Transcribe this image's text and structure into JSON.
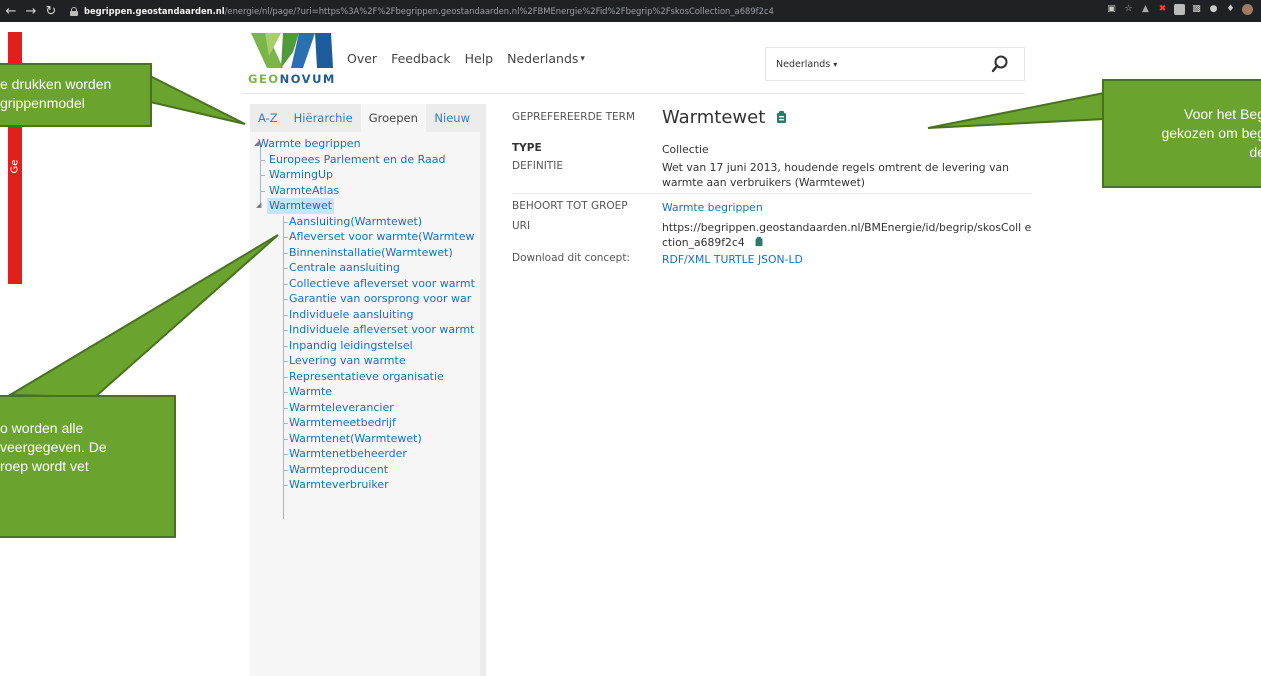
{
  "browser": {
    "url_host": "begrippen.geostandaarden.nl",
    "url_path": "/energie/nl/page/?uri=https%3A%2F%2Fbegrippen.geostandaarden.nl%2FBMEnergie%2Fid%2Fbegrip%2FskosCollection_a689f2c4"
  },
  "side": {
    "vertical_text": "Ge"
  },
  "header": {
    "logo_geo": "GEO",
    "logo_novum": "NOVUM",
    "nav": [
      "Over",
      "Feedback",
      "Help",
      "Nederlands"
    ],
    "search": {
      "language": "Nederlands",
      "placeholder": ""
    }
  },
  "tabs": [
    "A-Z",
    "Hiërarchie",
    "Groepen",
    "Nieuw"
  ],
  "tree": {
    "root": "Warmte begrippen",
    "level1": [
      "Europees Parlement en de Raad",
      "WarmingUp",
      "WarmteAtlas",
      "Warmtewet"
    ],
    "children": [
      "Aansluiting(Warmtewet)",
      "Afleverset voor warmte(Warmtew",
      "Binneninstallatie(Warmtewet)",
      "Centrale aansluiting",
      "Collectieve afleverset voor warmt",
      "Garantie van oorsprong voor war",
      "Individuele aansluiting",
      "Individuele afleverset voor warmt",
      "Inpandig leidingstelsel",
      "Levering van warmte",
      "Representatieve organisatie",
      "Warmte",
      "Warmteleverancier",
      "Warmtemeetbedrijf",
      "Warmtenet(Warmtewet)",
      "Warmtenetbeheerder",
      "Warmteproducent",
      "Warmteverbruiker"
    ]
  },
  "detail": {
    "pref_label_key": "GEPREFEREERDE TERM",
    "pref_label_value": "Warmtewet",
    "type_key": "TYPE",
    "type_value": "Collectie",
    "def_key": "DEFINITIE",
    "def_value": "Wet van 17 juni 2013, houdende regels omtrent de levering van warmte aan verbruikers (Warmtewet)",
    "group_key": "BEHOORT TOT GROEP",
    "group_value": "Warmte begrippen",
    "uri_key": "URI",
    "uri_value": "https://begrippen.geostandaarden.nl/BMEnergie/id/begrip/skosColl ection_a689f2c4",
    "download_key": "Download dit concept:",
    "download_links": [
      "RDF/XML",
      "TURTLE",
      "JSON-LD"
    ]
  },
  "callouts": {
    "left_top": "e drukken worden\ngrippenmodel",
    "left_bottom": "o worden alle\nveergegeven. De\nroep wordt vet",
    "right_top": "Voor het Beg\ngekozen om beg\nde"
  },
  "colors": {
    "callout_fill": "#6aa42e",
    "link": "#1a6fc1",
    "red_bar": "#e0201b"
  }
}
